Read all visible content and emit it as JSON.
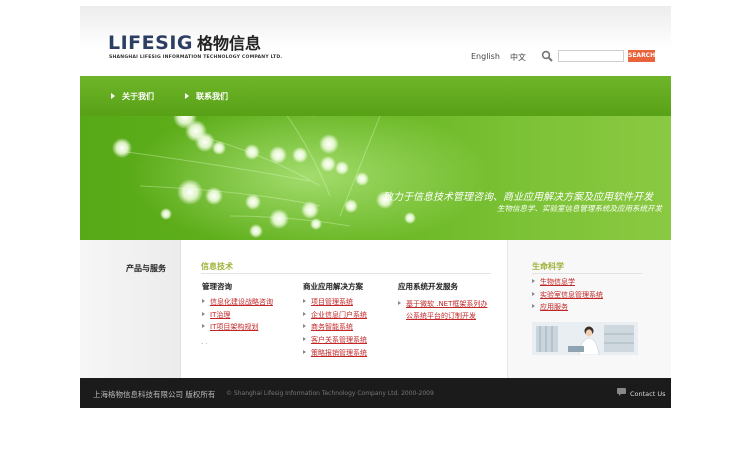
{
  "header": {
    "logo_word": "LIFESIG",
    "logo_cn": "格物信息",
    "logo_sub": "SHANGHAI LIFESIG INFORMATION TECHNOLOGY COMPANY LTD.",
    "lang_en": "English",
    "lang_cn": "中文",
    "search_icon": "magnifier-icon",
    "search_placeholder": "",
    "search_button": "SEARCH"
  },
  "nav": {
    "items": [
      {
        "label": "关于我们"
      },
      {
        "label": "联系我们"
      }
    ]
  },
  "banner": {
    "slogan": "致力于信息技术管理咨询、商业应用解决方案及应用软件开发",
    "sub": "生物信息学、实验室信息管理系统及应用系统开发"
  },
  "content": {
    "products_title": "产品与服务",
    "it": {
      "title": "信息技术",
      "columns": [
        {
          "heading": "管理咨询",
          "links": [
            "信息化建设战略咨询",
            "IT治理",
            "IT项目架构规划"
          ]
        },
        {
          "heading": "商业应用解决方案",
          "links": [
            "项目管理系统",
            "企业信息门户系统",
            "商务智能系统",
            "客户关系管理系统",
            "策略报销管理系统"
          ]
        },
        {
          "heading": "应用系统开发服务",
          "links": [
            "基于微软 .NET框架系列办公系统平台的订制开发"
          ]
        }
      ],
      "dots": ". ."
    },
    "life": {
      "title": "生命科学",
      "links": [
        "生物信息学",
        "实验室信息管理系统",
        "应用服务"
      ]
    }
  },
  "footer": {
    "cn": "上海格物信息科技有限公司  版权所有",
    "en": "© Shanghai Lifesig Information Technology Company Ltd. 2000-2009",
    "contact_icon": "chat-bubble-icon",
    "contact": "Contact Us"
  },
  "colors": {
    "brand_green": "#64b41f",
    "link_red": "#c22626",
    "search_orange": "#e8623a",
    "footer_bg": "#1b1b1b",
    "section_title": "#9fb239"
  }
}
